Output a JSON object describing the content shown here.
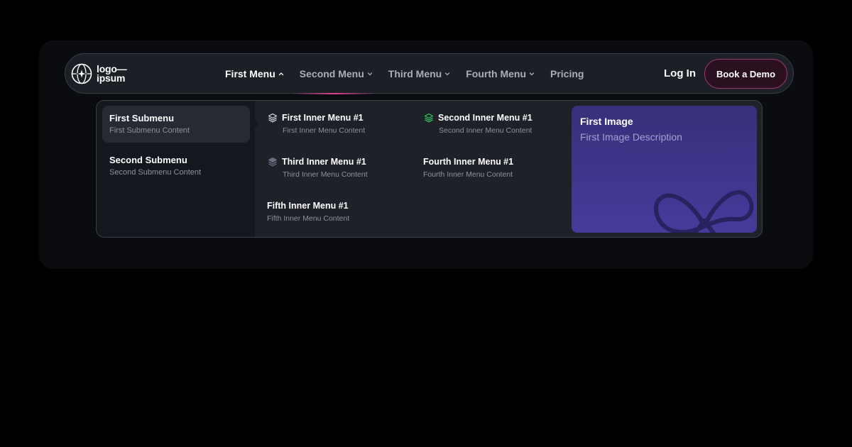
{
  "logo": {
    "line1": "logo—",
    "line2": "ipsum",
    "icon": "globe-star-icon"
  },
  "nav": {
    "items": [
      {
        "label": "First Menu",
        "has_dropdown": true,
        "expanded": true
      },
      {
        "label": "Second Menu",
        "has_dropdown": true,
        "expanded": false
      },
      {
        "label": "Third Menu",
        "has_dropdown": true,
        "expanded": false
      },
      {
        "label": "Fourth Menu",
        "has_dropdown": true,
        "expanded": false
      },
      {
        "label": "Pricing",
        "has_dropdown": false,
        "expanded": false
      }
    ],
    "login_label": "Log In",
    "demo_label": "Book a Demo"
  },
  "dropdown": {
    "submenus": [
      {
        "title": "First Submenu",
        "desc": "First Submenu Content",
        "active": true
      },
      {
        "title": "Second Submenu",
        "desc": "Second Submenu Content",
        "active": false
      }
    ],
    "inner_items": [
      {
        "title": "First Inner Menu #1",
        "desc": "First Inner Menu Content",
        "icon": "layers-icon",
        "icon_color": "#d8dbe2"
      },
      {
        "title": "Second Inner Menu #1",
        "desc": "Second Inner Menu Content",
        "icon": "layers-icon",
        "icon_color": "#34c759"
      },
      {
        "title": "Third Inner Menu #1",
        "desc": "Third Inner Menu Content",
        "icon": "layers-icon",
        "icon_color": "#6b7080"
      },
      {
        "title": "Fourth Inner Menu #1",
        "desc": "Fourth Inner Menu Content",
        "icon": "",
        "icon_color": ""
      },
      {
        "title": "Fifth Inner Menu #1",
        "desc": "Fifth Inner Menu Content",
        "icon": "",
        "icon_color": ""
      }
    ],
    "image_card": {
      "title": "First Image",
      "desc": "First Image Description",
      "icon": "infinity-loop-icon"
    }
  },
  "colors": {
    "background": "#000000",
    "frame": "#0b0c0f",
    "navbar": "#1c1f26",
    "accent_pink": "#ec4899",
    "card_purple": "#453b9b"
  }
}
